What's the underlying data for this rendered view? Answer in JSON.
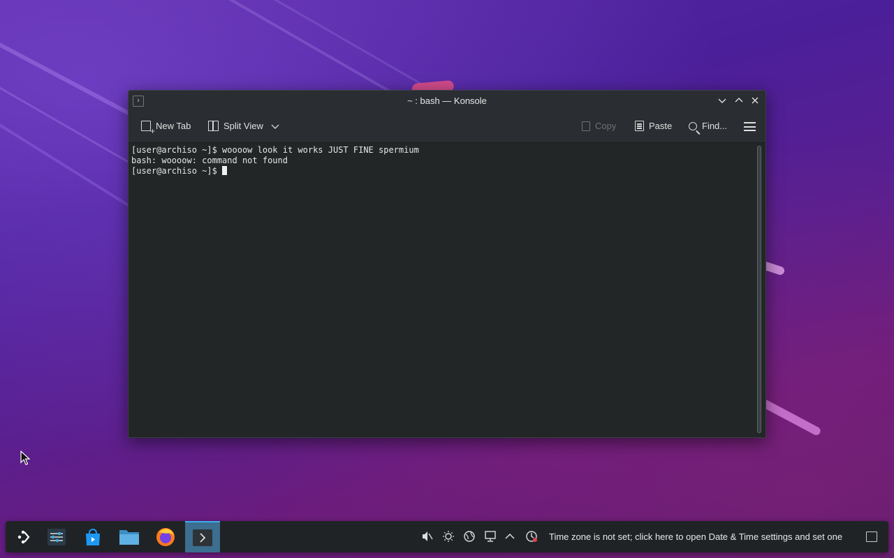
{
  "window": {
    "title": "~ : bash — Konsole",
    "toolbar": {
      "new_tab": "New Tab",
      "split_view": "Split View",
      "copy": "Copy",
      "paste": "Paste",
      "find": "Find..."
    },
    "terminal": {
      "lines": [
        "[user@archiso ~]$ woooow look it works JUST FINE spermium",
        "bash: woooow: command not found",
        "[user@archiso ~]$ "
      ]
    }
  },
  "panel": {
    "launchers": [
      {
        "name": "application-launcher-icon"
      },
      {
        "name": "system-settings-icon"
      },
      {
        "name": "discover-store-icon"
      },
      {
        "name": "file-manager-icon"
      },
      {
        "name": "firefox-icon"
      },
      {
        "name": "konsole-icon",
        "active": true
      }
    ],
    "tray": [
      "volume-muted-icon",
      "brightness-icon",
      "network-icon",
      "display-icon",
      "expand-tray-icon",
      "clock-icon"
    ],
    "notice": "Time zone is not set; click here to open Date & Time settings and set one"
  }
}
